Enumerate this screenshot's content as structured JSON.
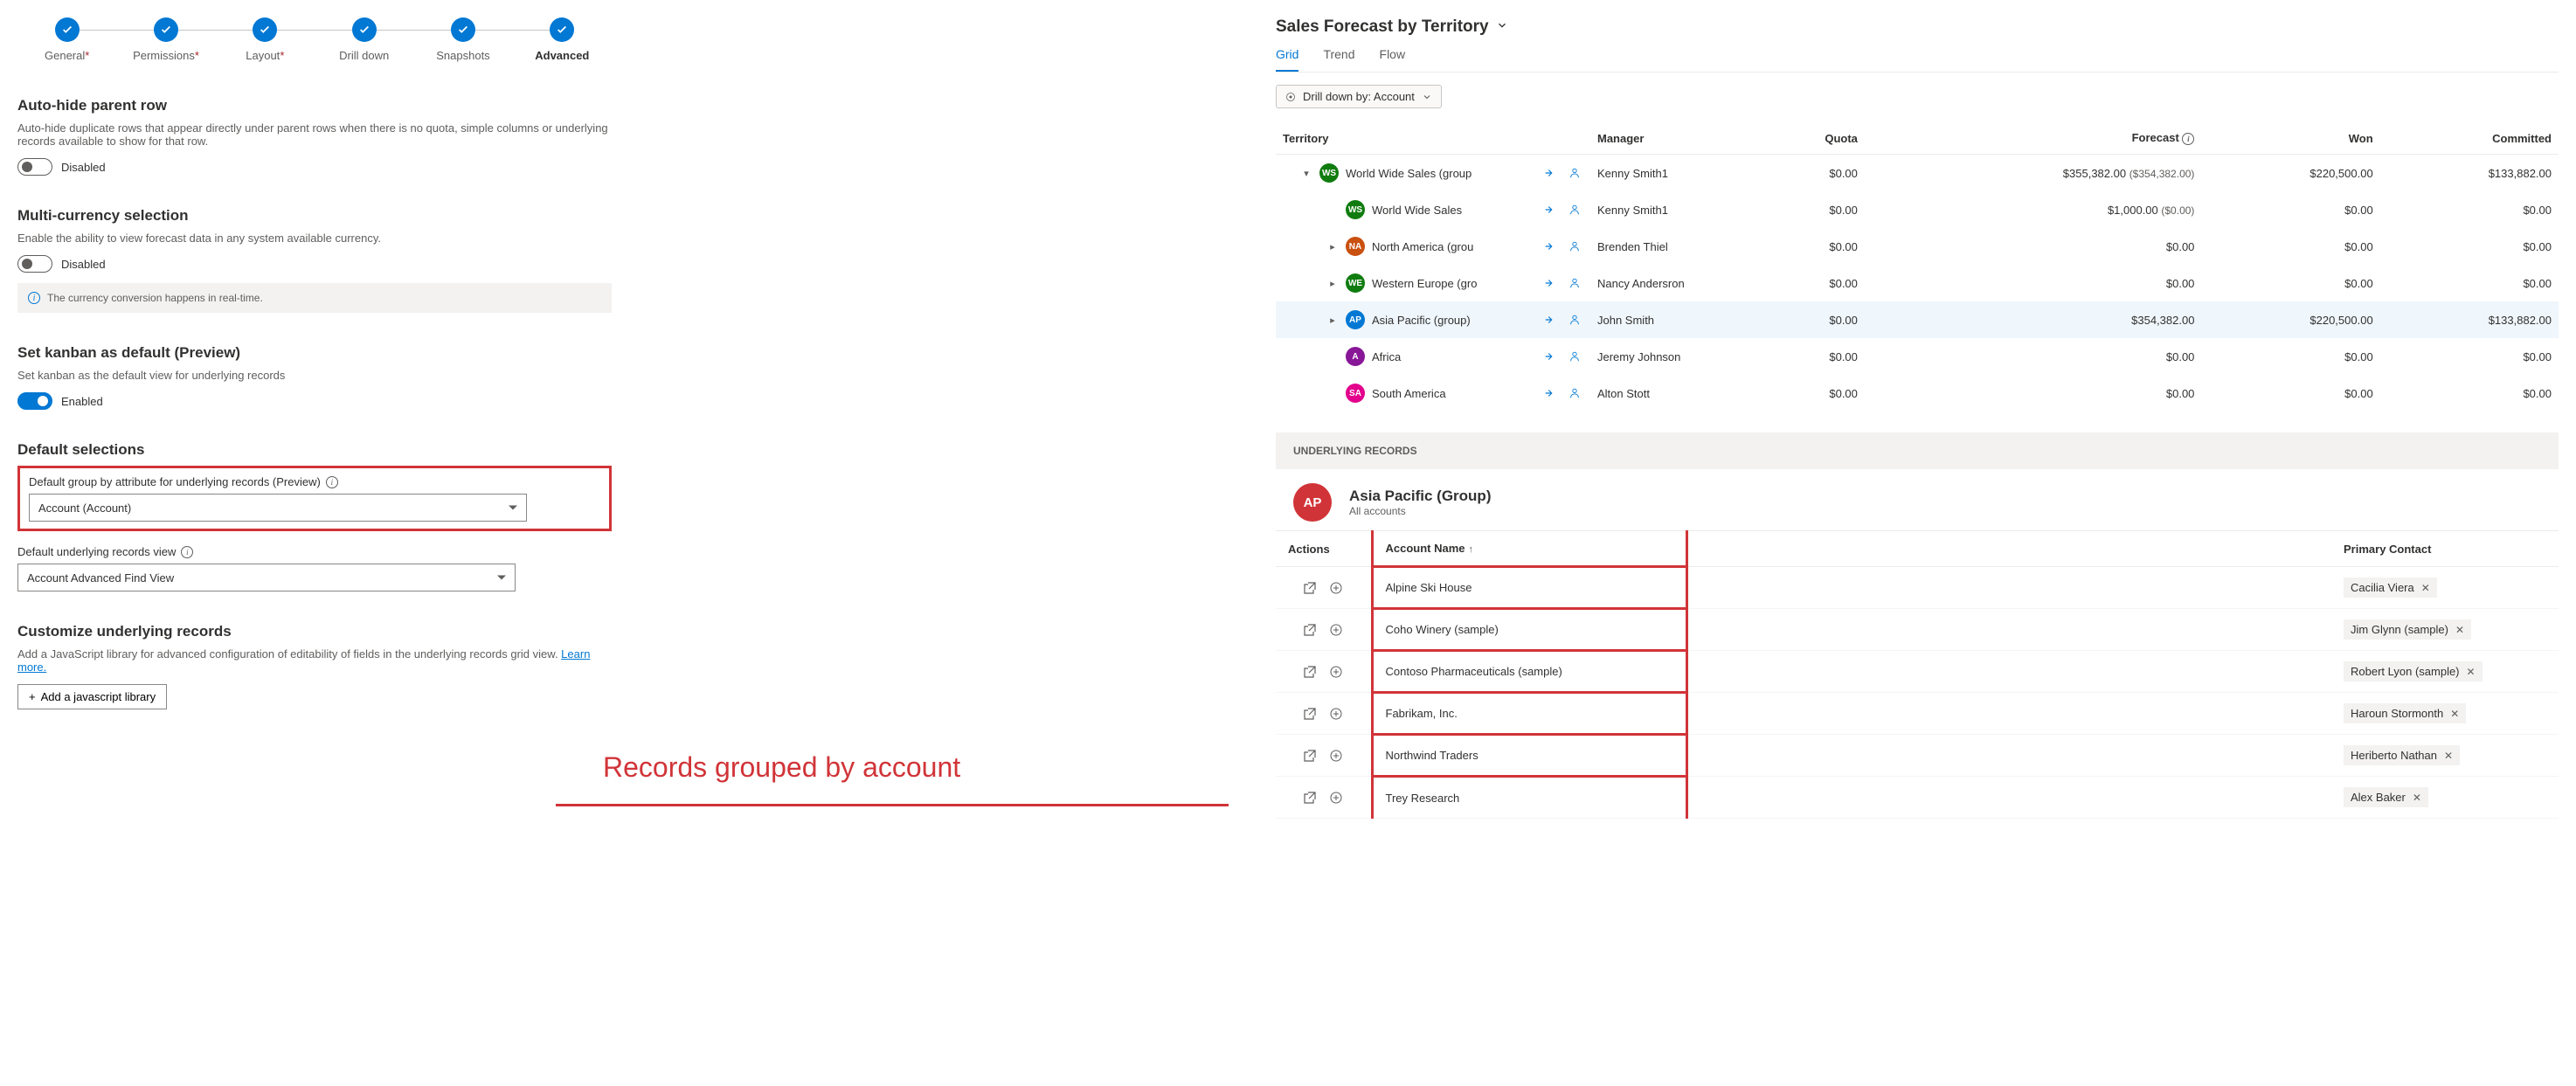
{
  "stepper": {
    "steps": [
      {
        "label": "General",
        "required": true
      },
      {
        "label": "Permissions",
        "required": true
      },
      {
        "label": "Layout",
        "required": true
      },
      {
        "label": "Drill down",
        "required": false
      },
      {
        "label": "Snapshots",
        "required": false
      },
      {
        "label": "Advanced",
        "required": false,
        "active": true
      }
    ]
  },
  "sections": {
    "autohide": {
      "title": "Auto-hide parent row",
      "desc": "Auto-hide duplicate rows that appear directly under parent rows when there is no quota, simple columns or underlying records available to show for that row.",
      "toggle": "Disabled"
    },
    "multicurrency": {
      "title": "Multi-currency selection",
      "desc": "Enable the ability to view forecast data in any system available currency.",
      "toggle": "Disabled",
      "info": "The currency conversion happens in real-time."
    },
    "kanban": {
      "title": "Set kanban as default (Preview)",
      "desc": "Set kanban as the default view for underlying records",
      "toggle": "Enabled"
    },
    "defaults": {
      "title": "Default selections",
      "group_label": "Default group by attribute for underlying records (Preview)",
      "group_value": "Account (Account)",
      "view_label": "Default underlying records view",
      "view_value": "Account Advanced Find View"
    },
    "customize": {
      "title": "Customize underlying records",
      "desc_a": "Add a JavaScript library for advanced configuration of editability of fields in the underlying records grid view. ",
      "learn_more": "Learn more.",
      "button": "Add a javascript library"
    }
  },
  "callout": "Records grouped by account",
  "forecast": {
    "title": "Sales Forecast by Territory",
    "tabs": [
      "Grid",
      "Trend",
      "Flow"
    ],
    "drill_chip": "Drill down by: Account",
    "headers": [
      "Territory",
      "Manager",
      "Quota",
      "Forecast",
      "Won",
      "Committed"
    ],
    "rows": [
      {
        "indent": 0,
        "expand": "down",
        "color": "#107c10",
        "initials": "WS",
        "name": "World Wide Sales (group",
        "manager": "Kenny Smith1",
        "quota": "$0.00",
        "forecast": "$355,382.00",
        "forecast_sub": "($354,382.00)",
        "won": "$220,500.00",
        "committed": "$133,882.00"
      },
      {
        "indent": 1,
        "expand": "",
        "color": "#107c10",
        "initials": "WS",
        "name": "World Wide Sales",
        "manager": "Kenny Smith1",
        "quota": "$0.00",
        "forecast": "$1,000.00",
        "forecast_sub": "($0.00)",
        "won": "$0.00",
        "committed": "$0.00"
      },
      {
        "indent": 1,
        "expand": "right",
        "color": "#ca5010",
        "initials": "NA",
        "name": "North America (grou",
        "manager": "Brenden Thiel",
        "quota": "$0.00",
        "forecast": "$0.00",
        "forecast_sub": "",
        "won": "$0.00",
        "committed": "$0.00"
      },
      {
        "indent": 1,
        "expand": "right",
        "color": "#107c10",
        "initials": "WE",
        "name": "Western Europe (gro",
        "manager": "Nancy Andersron",
        "quota": "$0.00",
        "forecast": "$0.00",
        "forecast_sub": "",
        "won": "$0.00",
        "committed": "$0.00"
      },
      {
        "indent": 1,
        "expand": "right",
        "color": "#0078d4",
        "initials": "AP",
        "name": "Asia Pacific (group)",
        "manager": "John Smith",
        "quota": "$0.00",
        "forecast": "$354,382.00",
        "forecast_sub": "",
        "won": "$220,500.00",
        "committed": "$133,882.00",
        "highlight": true
      },
      {
        "indent": 1,
        "expand": "",
        "color": "#881798",
        "initials": "A",
        "name": "Africa",
        "manager": "Jeremy Johnson",
        "quota": "$0.00",
        "forecast": "$0.00",
        "forecast_sub": "",
        "won": "$0.00",
        "committed": "$0.00"
      },
      {
        "indent": 1,
        "expand": "",
        "color": "#e3008c",
        "initials": "SA",
        "name": "South America",
        "manager": "Alton Stott",
        "quota": "$0.00",
        "forecast": "$0.00",
        "forecast_sub": "",
        "won": "$0.00",
        "committed": "$0.00"
      }
    ]
  },
  "underlying": {
    "bar": "UNDERLYING RECORDS",
    "avatar": "AP",
    "title": "Asia Pacific (Group)",
    "sub": "All accounts",
    "headers": {
      "actions": "Actions",
      "name": "Account Name",
      "contact": "Primary Contact"
    },
    "rows": [
      {
        "name": "Alpine Ski House",
        "contact": "Cacilia Viera"
      },
      {
        "name": "Coho Winery (sample)",
        "contact": "Jim Glynn (sample)"
      },
      {
        "name": "Contoso Pharmaceuticals (sample)",
        "contact": "Robert Lyon (sample)"
      },
      {
        "name": "Fabrikam, Inc.",
        "contact": "Haroun Stormonth"
      },
      {
        "name": "Northwind Traders",
        "contact": "Heriberto Nathan"
      },
      {
        "name": "Trey Research",
        "contact": "Alex Baker"
      }
    ]
  }
}
